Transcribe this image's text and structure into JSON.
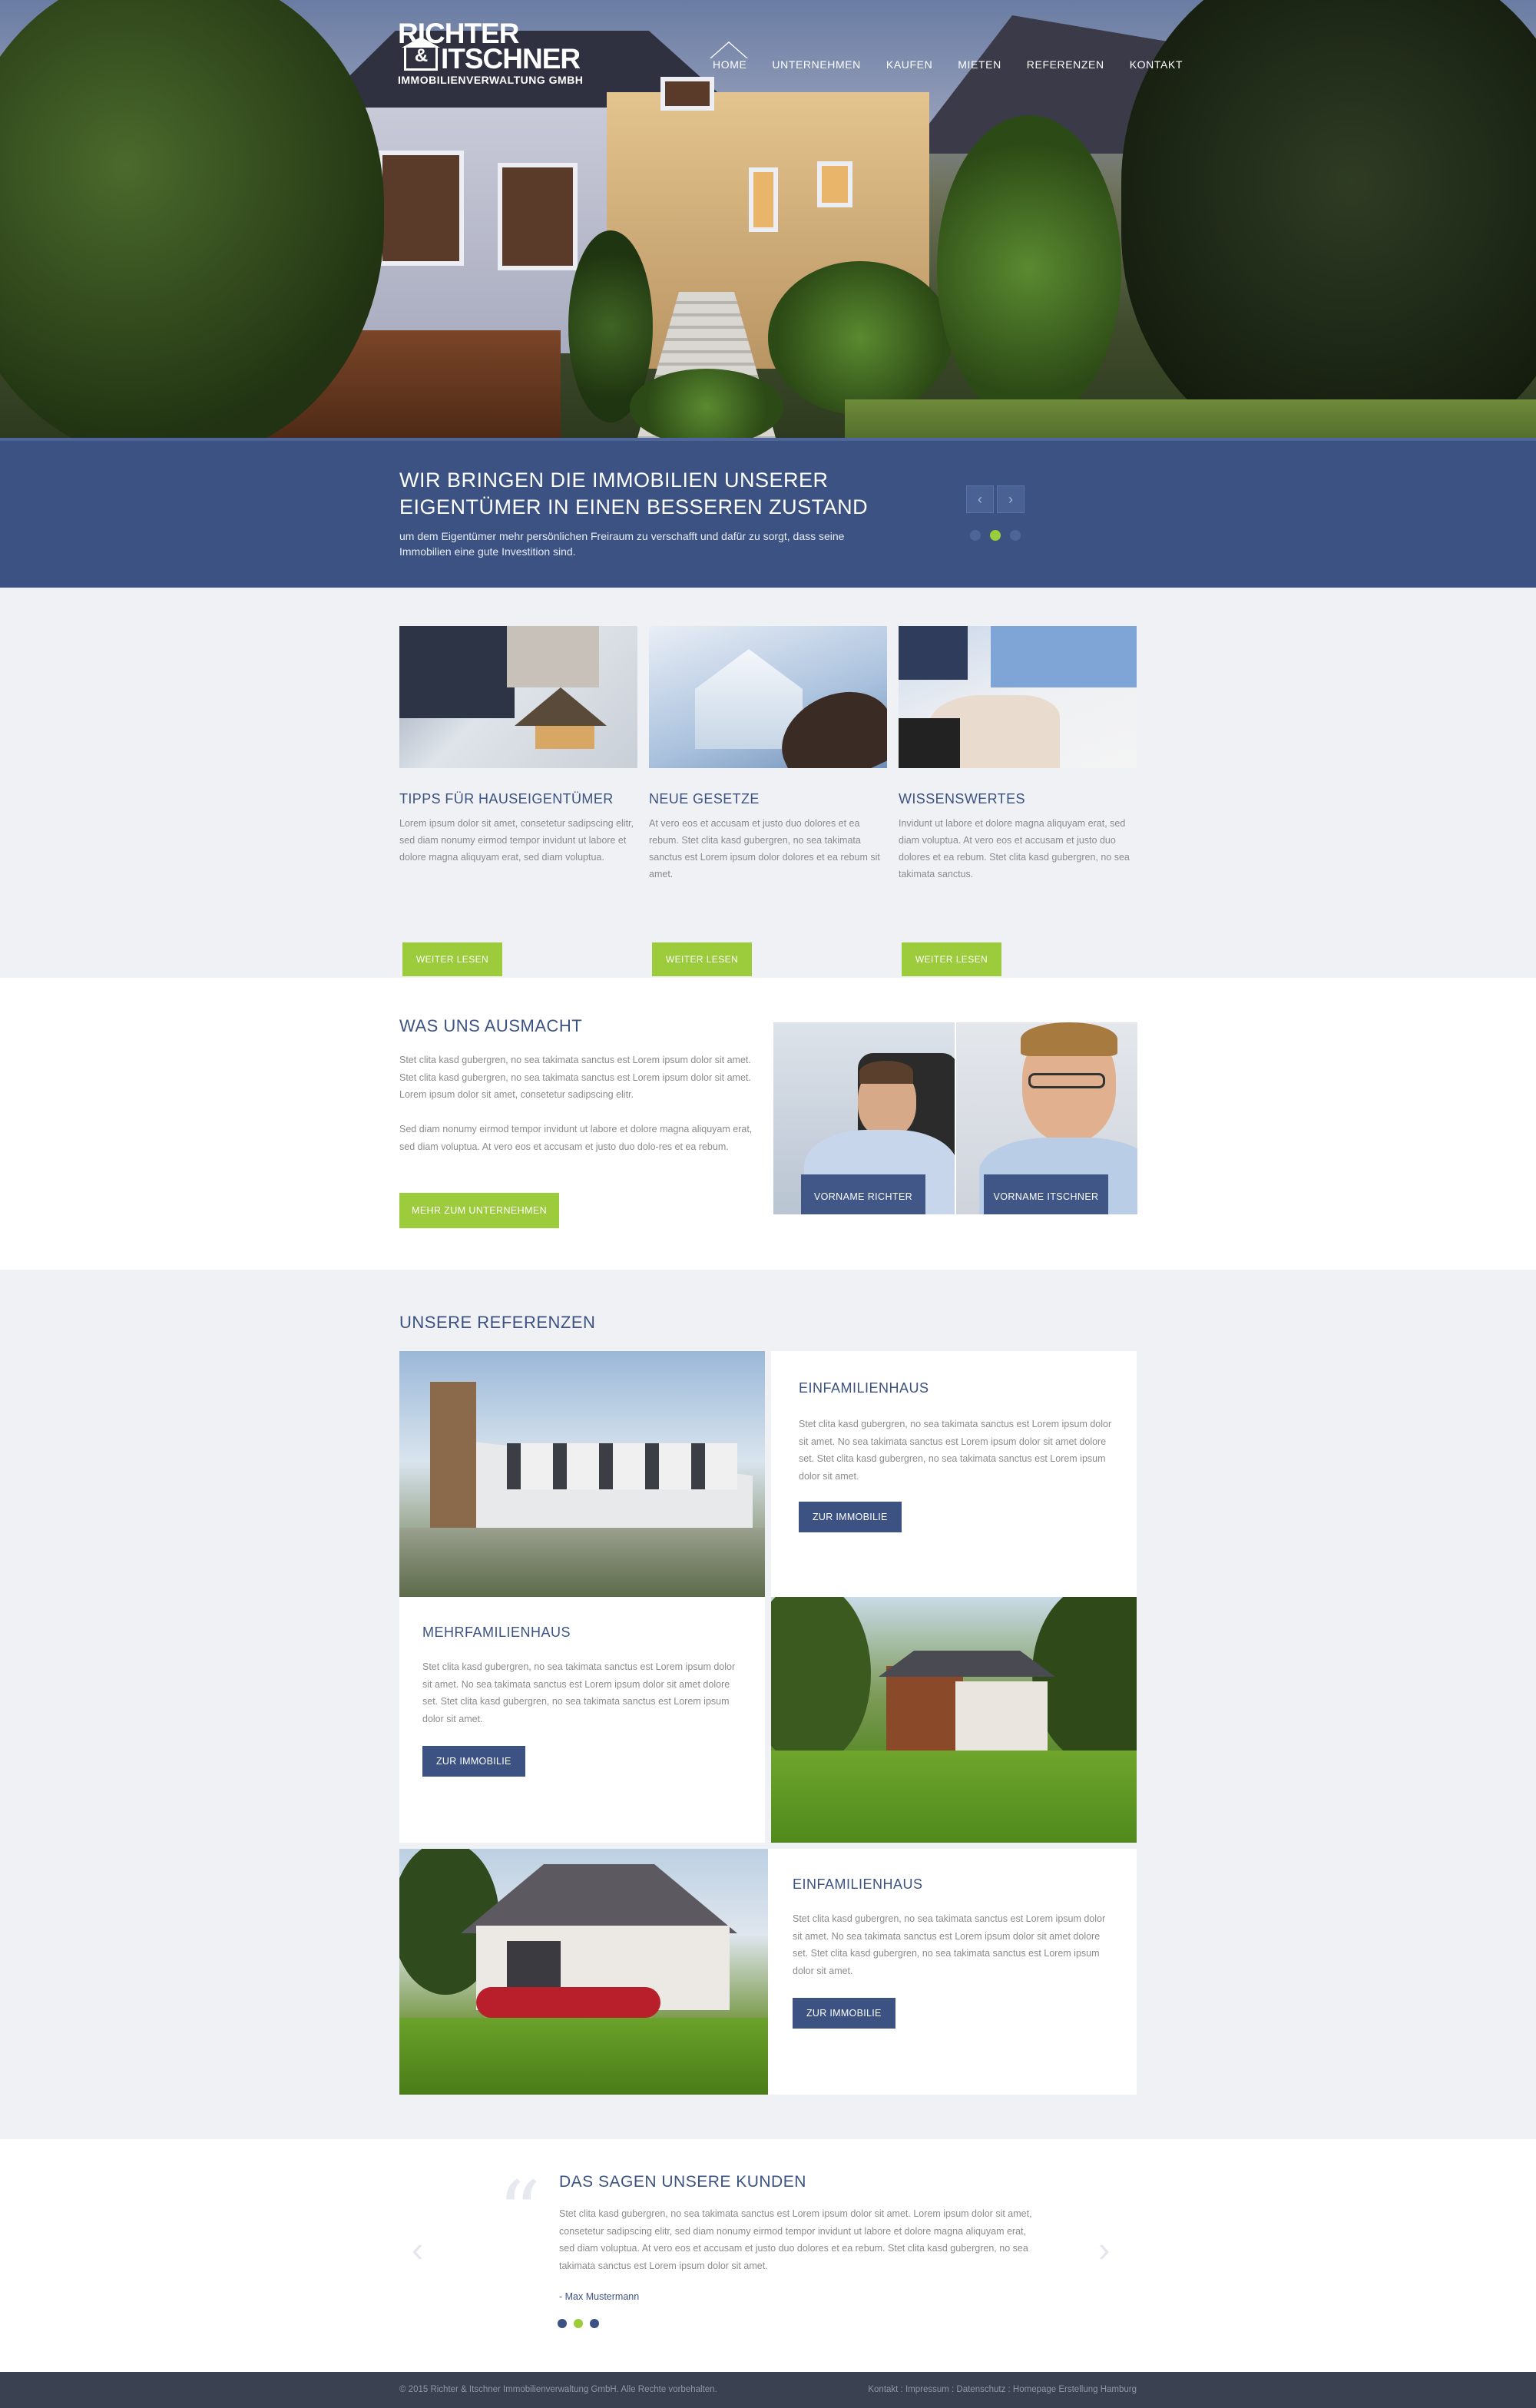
{
  "brand": {
    "line1": "RICHTER",
    "amp": "&",
    "line2": "ITSCHNER",
    "line3": "IMMOBILIENVERWALTUNG GMBH"
  },
  "nav": {
    "items": [
      {
        "label": "HOME",
        "active": true
      },
      {
        "label": "UNTERNEHMEN"
      },
      {
        "label": "KAUFEN"
      },
      {
        "label": "MIETEN"
      },
      {
        "label": "REFERENZEN"
      },
      {
        "label": "KONTAKT"
      }
    ]
  },
  "slider": {
    "title": "WIR BRINGEN DIE IMMOBILIEN UNSERER EIGENTÜMER  IN EINEN BESSEREN ZUSTAND",
    "text": "um dem Eigentümer mehr persönlichen Freiraum zu verschafft und dafür zu sorgt, dass seine Immobilien eine gute Investition sind.",
    "prev_icon": "‹",
    "next_icon": "›",
    "active_dot": 2,
    "dot_count": 3,
    "colors": {
      "bar": "#3b5283",
      "dot_active": "#9ccb3b"
    }
  },
  "features": [
    {
      "title": "TIPPS FÜR HAUSEIGENTÜMER",
      "text": "Lorem ipsum dolor sit amet, consetetur sadipscing elitr, sed diam nonumy eirmod tempor invidunt ut labore et dolore magna aliquyam erat, sed diam voluptua.",
      "button": "WEITER LESEN"
    },
    {
      "title": "NEUE GESETZE",
      "text": "At vero eos et accusam et justo duo dolores et ea rebum. Stet clita kasd gubergren, no sea takimata sanctus est Lorem ipsum dolor dolores et ea rebum sit amet.",
      "button": "WEITER LESEN"
    },
    {
      "title": "WISSENSWERTES",
      "text": "Invidunt ut labore et dolore magna aliquyam erat, sed diam voluptua. At vero eos et accusam et justo duo dolores et ea rebum. Stet clita kasd gubergren, no sea takimata sanctus.",
      "button": "WEITER LESEN"
    }
  ],
  "about": {
    "title": "WAS UNS AUSMACHT",
    "p1": "Stet clita kasd gubergren, no sea takimata sanctus est Lorem ipsum dolor sit amet. Stet clita kasd gubergren, no sea takimata sanctus est Lorem ipsum dolor sit amet. Lorem ipsum dolor sit amet, consetetur sadipscing elitr.",
    "p2": "Sed diam nonumy eirmod tempor invidunt ut labore et dolore magna aliquyam erat, sed diam voluptua. At vero eos et accusam et justo duo dolo-res et ea rebum.",
    "button": "MEHR ZUM UNTERNEHMEN",
    "people": [
      {
        "label": "VORNAME RICHTER"
      },
      {
        "label": "VORNAME ITSCHNER"
      }
    ]
  },
  "references": {
    "title": "UNSERE REFERENZEN",
    "items": [
      {
        "title": "EINFAMILIENHAUS",
        "text": "Stet clita kasd gubergren, no sea takimata sanctus est Lorem ipsum dolor sit amet. No sea takimata sanctus est Lorem ipsum dolor sit amet dolore set. Stet clita kasd gubergren, no sea takimata sanctus est Lorem ipsum dolor sit amet.",
        "button": "ZUR IMMOBILIE"
      },
      {
        "title": "MEHRFAMILIENHAUS",
        "text": "Stet clita kasd gubergren, no sea takimata sanctus est Lorem ipsum dolor sit amet. No sea takimata sanctus est Lorem ipsum dolor sit amet dolore set. Stet clita kasd gubergren, no sea takimata sanctus est Lorem ipsum dolor sit amet.",
        "button": "ZUR IMMOBILIE"
      },
      {
        "title": "EINFAMILIENHAUS",
        "text": "Stet clita kasd gubergren, no sea takimata sanctus est Lorem ipsum dolor sit amet. No sea takimata sanctus est Lorem ipsum dolor sit amet dolore set. Stet clita kasd gubergren, no sea takimata sanctus est Lorem ipsum dolor sit amet.",
        "button": "ZUR IMMOBILIE"
      }
    ]
  },
  "testimonial": {
    "quote_icon": "“",
    "title": "DAS SAGEN UNSERE KUNDEN",
    "text": "Stet clita kasd gubergren, no sea takimata sanctus est Lorem ipsum dolor sit amet. Lorem ipsum dolor sit amet, consetetur sadipscing elitr, sed diam nonumy eirmod tempor invidunt ut labore et dolore magna aliquyam erat, sed diam voluptua. At vero eos et accusam et justo duo dolores et ea rebum. Stet clita kasd gubergren, no sea takimata sanctus est Lorem ipsum dolor sit amet.",
    "author": "- Max Mustermann",
    "prev_icon": "‹",
    "next_icon": "›"
  },
  "footer": {
    "copyright": "© 2015 Richter & Itschner Immobilienverwaltung GmbH. Alle Rechte vorbehalten.",
    "links": "Kontakt  :  Impressum  :  Datenschutz  :  Homepage Erstellung Hamburg"
  }
}
